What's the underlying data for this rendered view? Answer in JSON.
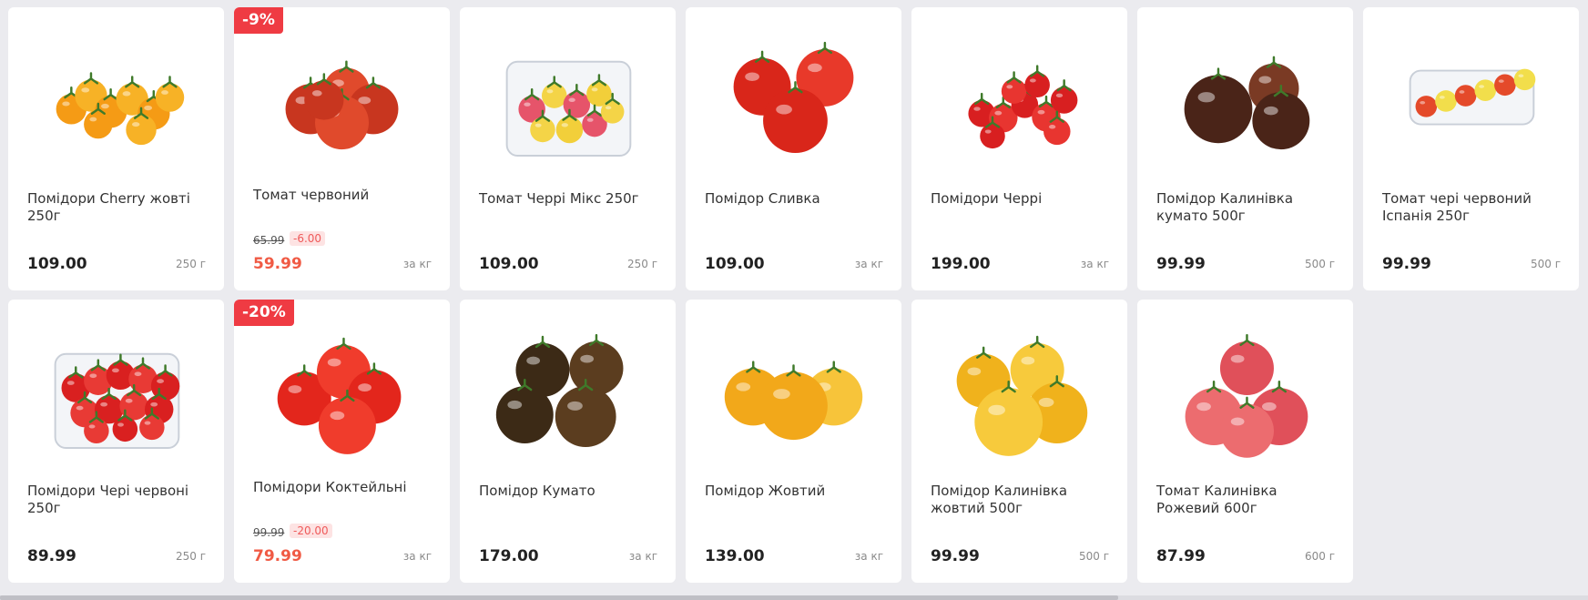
{
  "products": [
    {
      "title": "Помідори Cherry жовті 250г",
      "price": "109.00",
      "unit": "250 г",
      "badge": "",
      "old_price": "",
      "diff": "",
      "icon": "yellow-cherry-vine-image",
      "colors": [
        "#f59b15",
        "#f7b226"
      ]
    },
    {
      "title": "Томат червоний",
      "price": "59.99",
      "unit": "за кг",
      "badge": "-9%",
      "old_price": "65.99",
      "diff": "-6.00",
      "icon": "red-tomato-image",
      "colors": [
        "#c8361f",
        "#e04a2c"
      ]
    },
    {
      "title": "Томат Черрі Мікс 250г",
      "price": "109.00",
      "unit": "250 г",
      "badge": "",
      "old_price": "",
      "diff": "",
      "icon": "cherry-mix-box-image",
      "colors": [
        "#e6546a",
        "#f2cf3a"
      ]
    },
    {
      "title": "Помідор Сливка",
      "price": "109.00",
      "unit": "за кг",
      "badge": "",
      "old_price": "",
      "diff": "",
      "icon": "plum-tomato-image",
      "colors": [
        "#d9261a",
        "#e8392a"
      ]
    },
    {
      "title": "Помідори Черрі",
      "price": "199.00",
      "unit": "за кг",
      "badge": "",
      "old_price": "",
      "diff": "",
      "icon": "cherry-vine-image",
      "colors": [
        "#d81f20",
        "#e83530"
      ]
    },
    {
      "title": "Помідор Калинівка кумато 500г",
      "price": "99.99",
      "unit": "500 г",
      "badge": "",
      "old_price": "",
      "diff": "",
      "icon": "kumato-tomato-image",
      "colors": [
        "#4a2418",
        "#7a3a24"
      ]
    },
    {
      "title": "Томат чері червоний Іспанія 250г",
      "price": "99.99",
      "unit": "500 г",
      "badge": "",
      "old_price": "",
      "diff": "",
      "icon": "cherry-pack-image",
      "colors": [
        "#e44a2a",
        "#f3e04b"
      ]
    },
    {
      "title": "Помідори Чері червоні 250г",
      "price": "89.99",
      "unit": "250 г",
      "badge": "",
      "old_price": "",
      "diff": "",
      "icon": "cherry-box-image",
      "colors": [
        "#d92020",
        "#e83a35"
      ]
    },
    {
      "title": "Помідори Коктейльні",
      "price": "79.99",
      "unit": "за кг",
      "badge": "-20%",
      "old_price": "99.99",
      "diff": "-20.00",
      "icon": "cocktail-tomato-image",
      "colors": [
        "#e3261c",
        "#f03c2c"
      ]
    },
    {
      "title": "Помідор Кумато",
      "price": "179.00",
      "unit": "за кг",
      "badge": "",
      "old_price": "",
      "diff": "",
      "icon": "kumato-image",
      "colors": [
        "#3c2a16",
        "#5b3d1f"
      ]
    },
    {
      "title": "Помідор Жовтий",
      "price": "139.00",
      "unit": "за кг",
      "badge": "",
      "old_price": "",
      "diff": "",
      "icon": "yellow-tomato-image",
      "colors": [
        "#f2a81a",
        "#f7c43a"
      ]
    },
    {
      "title": "Помідор Калинівка жовтий 500г",
      "price": "99.99",
      "unit": "500 г",
      "badge": "",
      "old_price": "",
      "diff": "",
      "icon": "yellow-kalynivka-image",
      "colors": [
        "#f0b21c",
        "#f7ca3c"
      ]
    },
    {
      "title": "Томат Калинівка Рожевий 600г",
      "price": "87.99",
      "unit": "600 г",
      "badge": "",
      "old_price": "",
      "diff": "",
      "icon": "pink-tomato-image",
      "colors": [
        "#e0505a",
        "#ec6c6f"
      ]
    }
  ]
}
